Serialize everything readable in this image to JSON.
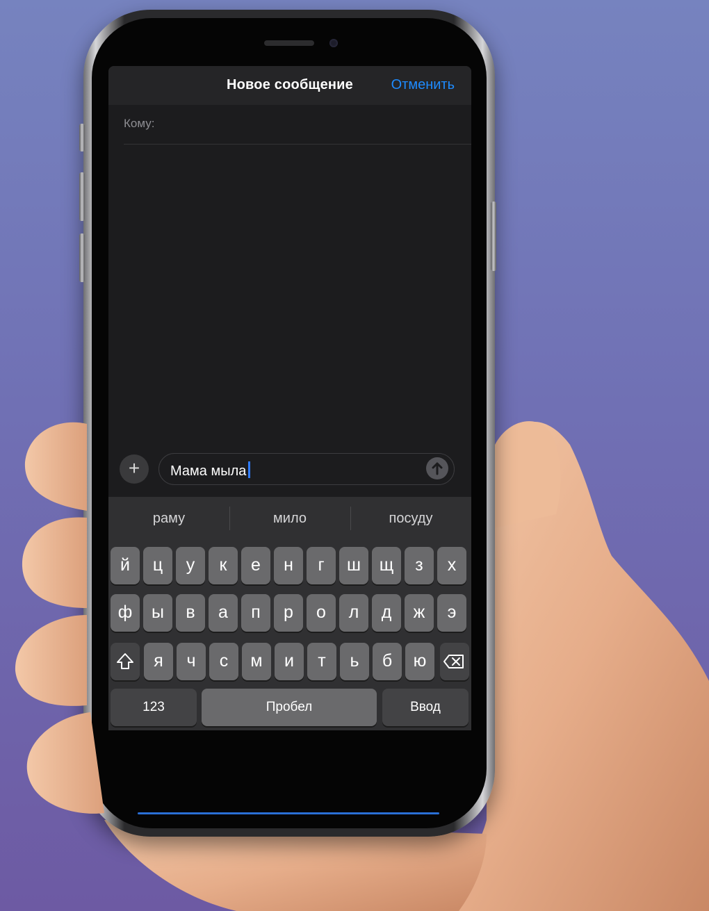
{
  "window": {
    "title": "Новое сообщение",
    "cancel_label": "Отменить"
  },
  "recipient": {
    "label": "Кому:"
  },
  "composer": {
    "text": "Мама мыла",
    "add_icon": "plus-icon",
    "send_icon": "arrow-up-icon"
  },
  "suggestions": [
    "раму",
    "мило",
    "посуду"
  ],
  "keyboard": {
    "row1": [
      "й",
      "ц",
      "у",
      "к",
      "е",
      "н",
      "г",
      "ш",
      "щ",
      "з",
      "х"
    ],
    "row2": [
      "ф",
      "ы",
      "в",
      "а",
      "п",
      "р",
      "о",
      "л",
      "д",
      "ж",
      "э"
    ],
    "row3": [
      "я",
      "ч",
      "с",
      "м",
      "и",
      "т",
      "ь",
      "б",
      "ю"
    ],
    "shift_icon": "shift-icon",
    "delete_icon": "backspace-icon",
    "numbers_label": "123",
    "space_label": "Пробел",
    "return_label": "Ввод"
  },
  "colors": {
    "accent": "#1e8bff",
    "background": "#1c1c1e",
    "key": "#6a6a6c",
    "key_dark": "#434345"
  }
}
